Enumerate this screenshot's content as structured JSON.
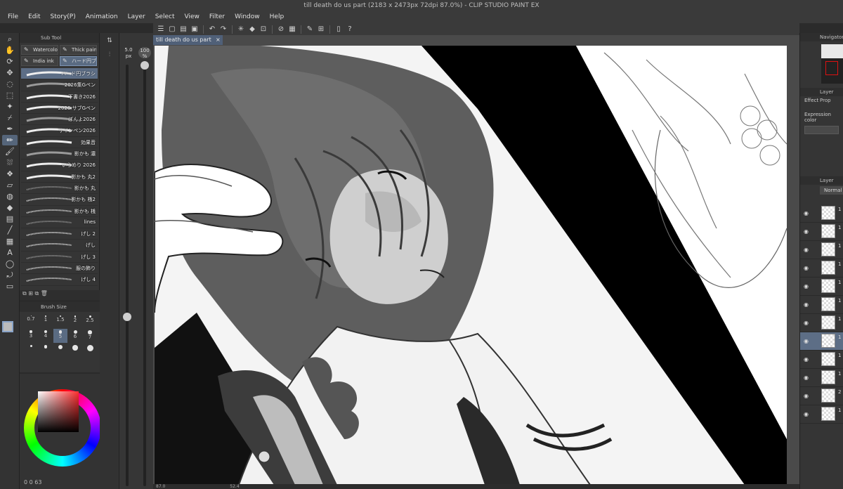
{
  "window": {
    "title": "till death do us part (2183 x 2473px 72dpi 87.0%) - CLIP STUDIO PAINT EX"
  },
  "menu": [
    "File",
    "Edit",
    "Story(P)",
    "Animation",
    "Layer",
    "Select",
    "View",
    "Filter",
    "Window",
    "Help"
  ],
  "command_icons": [
    "menu-icon",
    "new-icon",
    "open-icon",
    "save-icon",
    "undo-icon",
    "redo-icon",
    "clear-icon",
    "fill-icon",
    "transform-icon",
    "snap-icon",
    "ruler-icon",
    "pen-pressure-icon",
    "guide-icon",
    "phone-icon",
    "help-icon"
  ],
  "toolbar": {
    "tools": [
      "zoom-icon",
      "hand-icon",
      "rotate-icon",
      "move-icon",
      "lasso-icon",
      "select-icon",
      "wand-icon",
      "eyedropper-icon",
      "pen-icon",
      "pencil-icon",
      "brush-icon",
      "airbrush-icon",
      "decoration-icon",
      "eraser-icon",
      "blend-icon",
      "fill-icon",
      "gradient-icon",
      "figure-icon",
      "frame-icon",
      "text-icon",
      "balloon-icon",
      "correct-icon",
      "ruler-icon"
    ],
    "active_index": 9
  },
  "subtool": {
    "panel_title": "Sub Tool",
    "tabs": [
      {
        "label": "Watercolor",
        "icon": "watercolor-icon",
        "active": false
      },
      {
        "label": "Thick paint",
        "icon": "thick-paint-icon",
        "active": false
      },
      {
        "label": "India ink",
        "icon": "india-ink-icon",
        "active": false
      },
      {
        "label": "ハード円ブ",
        "icon": "hard-round-icon",
        "active": true
      }
    ],
    "brushes": [
      "ハード円ブラシ",
      "2026集Gペン",
      "下書き2026",
      "2026 サブGペン",
      "ぼんよ2026",
      "サインペン2026",
      "効果音",
      "影かも 濃",
      "いらめり 2026",
      "影かも 丸2",
      "影かも 丸",
      "影かも 桟2",
      "影かも 桟",
      "lines",
      "げし 2",
      "げし",
      "げし 3",
      "服の飾り",
      "げし 4"
    ],
    "active_brush": 0
  },
  "brush_size": {
    "panel_title": "Brush Size",
    "sizes": [
      "0.7",
      "1",
      "1.5",
      "2",
      "2.5",
      "3",
      "4",
      "5",
      "6",
      "7",
      "",
      "",
      "",
      "",
      ""
    ],
    "active_index": 7
  },
  "brush_readout": {
    "size": "5.0",
    "unit": "px",
    "opacity": "100",
    "opacity_unit": "%"
  },
  "color": {
    "main": "#ffffff",
    "picked": "#7a1a1a",
    "bottom_text": "0 0 63"
  },
  "canvas": {
    "tab_label": "till death do us part",
    "zoom": "87.0",
    "angle": "52.4"
  },
  "navigator": {
    "title": "Navigator"
  },
  "layer_property": {
    "title": "Layer Prop",
    "effect_label": "Effect",
    "expression_label": "Expression color"
  },
  "layers": {
    "title": "Layer",
    "blend_mode": "Normal",
    "rows": [
      "1",
      "1",
      "1",
      "1",
      "1",
      "1",
      "1",
      "1",
      "1",
      "1",
      "2",
      "1"
    ],
    "active_index": 7
  }
}
